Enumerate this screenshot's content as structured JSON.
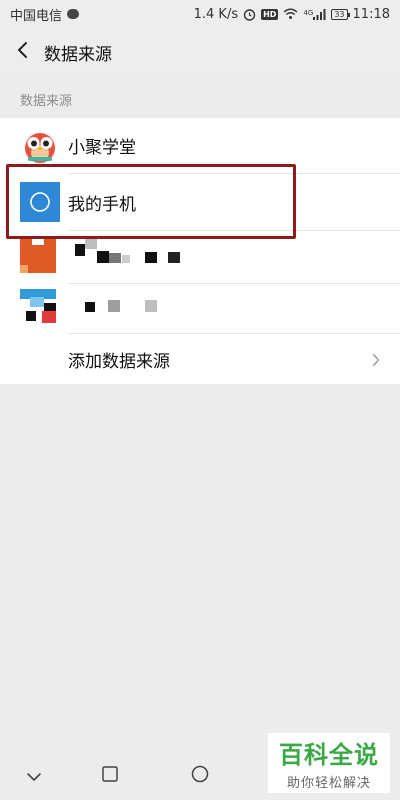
{
  "status_bar": {
    "carrier": "中国电信",
    "speed": "1.4 K/s",
    "hd": "HD",
    "network": "4G",
    "battery": "33",
    "time": "11:18"
  },
  "nav": {
    "title": "数据来源"
  },
  "section": {
    "header": "数据来源"
  },
  "list": {
    "items": [
      {
        "label": "小聚学堂",
        "icon": "owl-avatar-icon"
      },
      {
        "label": "我的手机",
        "icon": "phone-circle-icon"
      },
      {
        "label": "",
        "icon": "pixelated-app-icon"
      },
      {
        "label": "",
        "icon": "pixelated-app-icon"
      }
    ],
    "add_source": "添加数据来源"
  },
  "watermark": {
    "main": "百科全说",
    "sub": "助你轻松解决"
  },
  "colors": {
    "accent_blue": "#2f88d6",
    "highlight_red": "#8e1b1b",
    "watermark_green": "#3aa845"
  }
}
